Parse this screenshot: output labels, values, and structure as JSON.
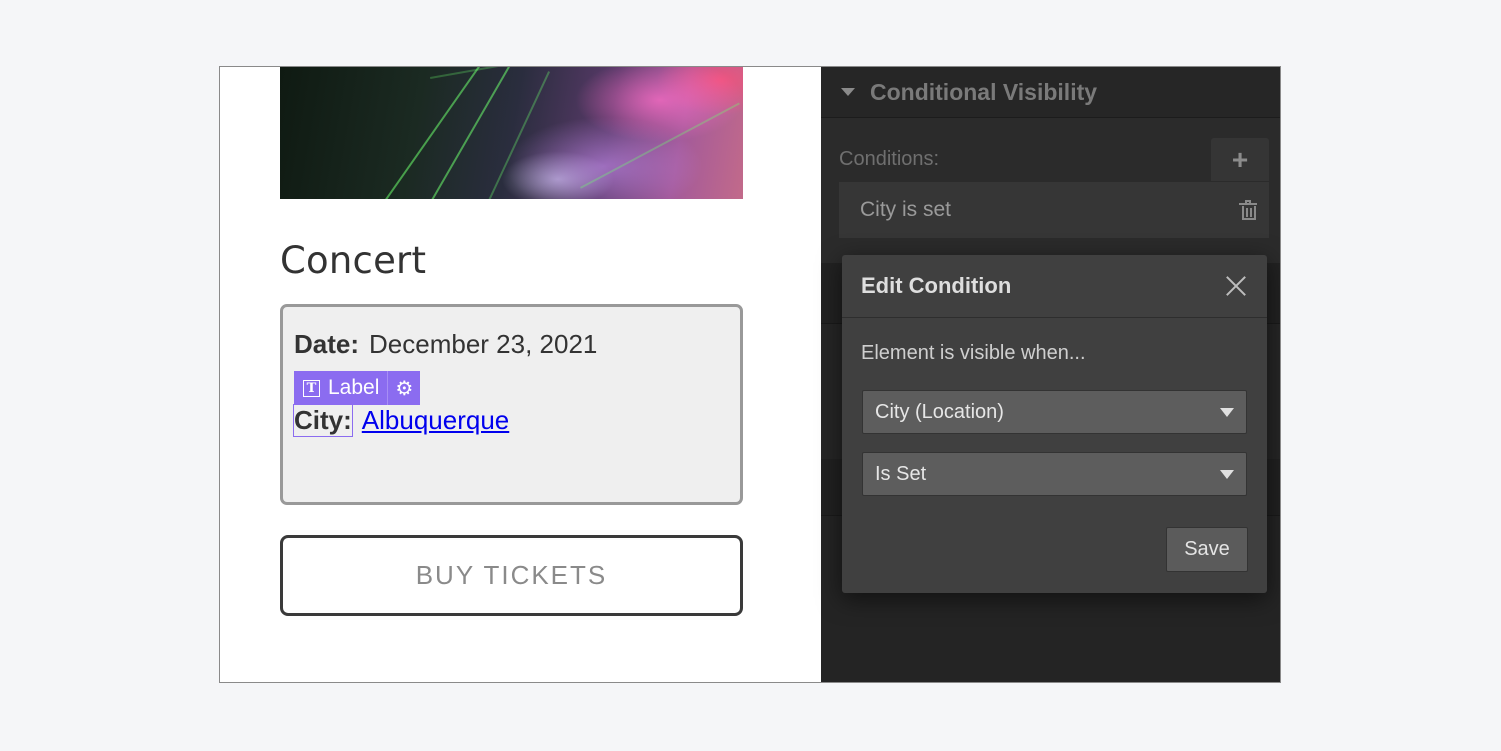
{
  "canvas": {
    "hero_image_alt": "orchestra-concert-photo",
    "title": "Concert",
    "date_label": "Date:",
    "date_value": "December 23, 2021",
    "selection_tag": {
      "label": "Label",
      "type_icon": "T",
      "settings_icon": "⚙"
    },
    "city_label": "City:",
    "city_value": "Albuquerque",
    "buy_button": "BUY TICKETS",
    "accent_color": "#8b6cf0",
    "link_color": "#0000ee"
  },
  "panel": {
    "section_title": "Conditional Visibility",
    "conditions_label": "Conditions:",
    "add_button": "+",
    "conditions": [
      {
        "text": "City is set"
      }
    ]
  },
  "modal": {
    "title": "Edit Condition",
    "description": "Element is visible when...",
    "field_select": {
      "value": "City (Location)"
    },
    "operator_select": {
      "value": "Is Set"
    },
    "save_button": "Save"
  }
}
